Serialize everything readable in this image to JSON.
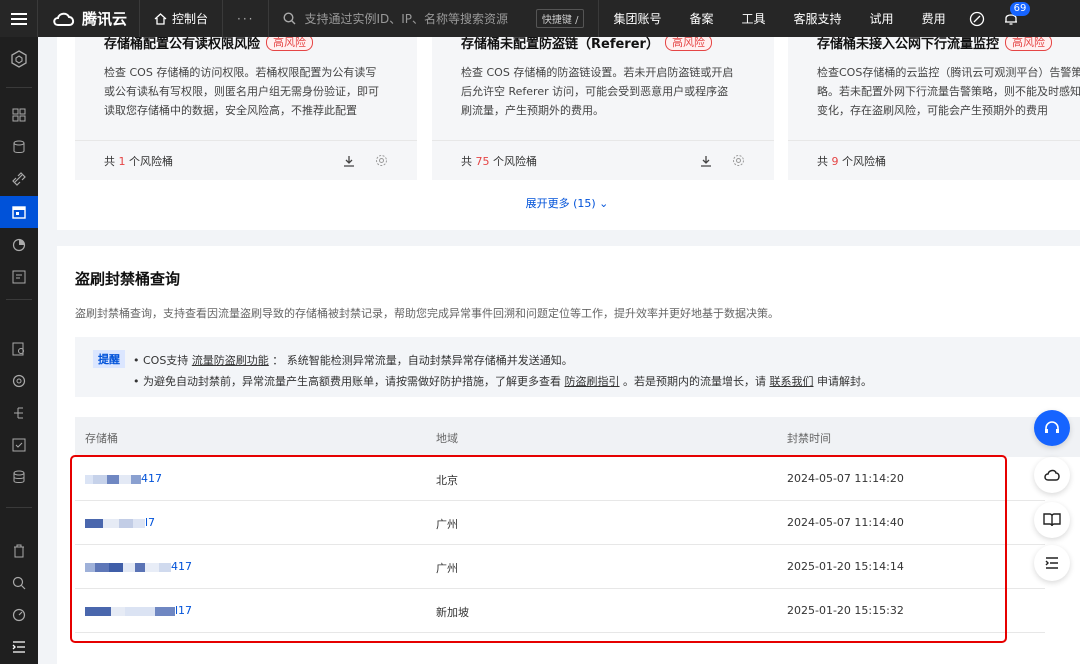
{
  "topbar": {
    "brand": "腾讯云",
    "console": "控制台",
    "more": "···",
    "search_placeholder": "支持通过实例ID、IP、名称等搜索资源",
    "shortcut": "快捷键 /",
    "nav": [
      "集团账号",
      "备案",
      "工具",
      "客服支持",
      "试用",
      "费用"
    ],
    "notification_count": "69"
  },
  "risk_cards": [
    {
      "title": "存储桶配置公有读权限风险",
      "level": "高风险",
      "desc": "检查 COS 存储桶的访问权限。若桶权限配置为公有读写或公有读私有写权限，则匿名用户组无需身份验证，即可读取您存储桶中的数据，安全风险高，不推荐此配置",
      "count_prefix": "共 ",
      "count": "1",
      "count_suffix": " 个风险桶"
    },
    {
      "title": "存储桶未配置防盗链（Referer）",
      "level": "高风险",
      "desc": "检查 COS 存储桶的防盗链设置。若未开启防盗链或开启后允许空 Referer 访问，可能会受到恶意用户或程序盗刷流量，产生预期外的费用。",
      "count_prefix": "共 ",
      "count": "75",
      "count_suffix": " 个风险桶"
    },
    {
      "title": "存储桶未接入公网下行流量监控",
      "level": "高风险",
      "desc": "检查COS存储桶的云监控（腾讯云可观测平台）告警策略。若未配置外网下行流量告警策略，则不能及时感知量变化，存在盗刷风险，可能会产生预期外的费用",
      "count_prefix": "共 ",
      "count": "9",
      "count_suffix": " 个风险桶"
    }
  ],
  "expand_more": "展开更多 (15)",
  "section": {
    "title": "盗刷封禁桶查询",
    "desc": "盗刷封禁桶查询，支持查看因流量盗刷导致的存储桶被封禁记录，帮助您完成异常事件回溯和问题定位等工作，提升效率并更好地基于数据决策。",
    "notice_tag": "提醒",
    "notice_line1_a": "• COS支持 ",
    "notice_line1_link": "流量防盗刷功能",
    "notice_line1_b": " ： 系统智能检测异常流量，自动封禁异常存储桶并发送通知。",
    "notice_line2_a": "• 为避免自动封禁前，异常流量产生高额费用账单，请按需做好防护措施，了解更多查看 ",
    "notice_line2_link1": "防盗刷指引",
    "notice_line2_b": " 。若是预期内的流量增长，请 ",
    "notice_line2_link2": "联系我们",
    "notice_line2_c": " 申请解封。"
  },
  "table": {
    "headers": [
      "存储桶",
      "地域",
      "封禁时间"
    ],
    "rows": [
      {
        "bucket_suffix": "417",
        "region": "北京",
        "time": "2024-05-07 11:14:20"
      },
      {
        "bucket_suffix": "l7",
        "region": "广州",
        "time": "2024-05-07 11:14:40"
      },
      {
        "bucket_suffix": "417",
        "region": "广州",
        "time": "2025-01-20 15:14:14"
      },
      {
        "bucket_suffix": "l17",
        "region": "新加坡",
        "time": "2025-01-20 15:15:32"
      }
    ]
  },
  "colors": {
    "accent": "#0052d9",
    "danger": "#e54545",
    "highlight_box": "#e60000"
  }
}
